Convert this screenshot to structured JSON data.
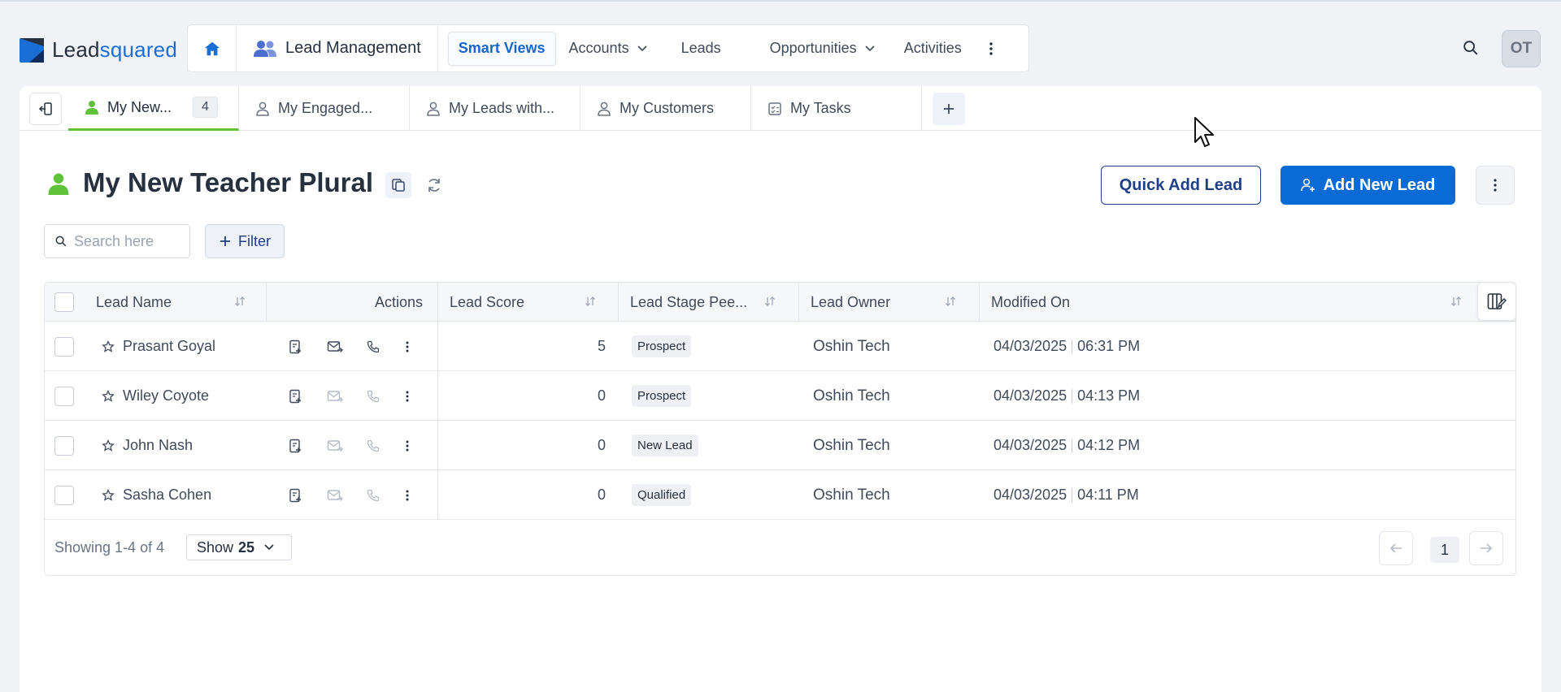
{
  "brand": {
    "name_part1": "Lead",
    "name_part2": "squared",
    "accent": "#1a6fd6"
  },
  "nav": {
    "module": "Lead Management",
    "items": [
      {
        "label": "Smart Views",
        "active": true
      },
      {
        "label": "Accounts",
        "dropdown": true
      },
      {
        "label": "Leads"
      },
      {
        "label": "Opportunities",
        "dropdown": true
      },
      {
        "label": "Activities"
      }
    ]
  },
  "user": {
    "initials": "OT"
  },
  "tabs": [
    {
      "label": "My New...",
      "count": "4",
      "active": true
    },
    {
      "label": "My Engaged..."
    },
    {
      "label": "My Leads with..."
    },
    {
      "label": "My Customers"
    },
    {
      "label": "My Tasks"
    }
  ],
  "page": {
    "title": "My New Teacher Plural",
    "quick_add_label": "Quick Add Lead",
    "add_new_label": "Add New Lead",
    "search_placeholder": "Search here",
    "filter_label": "Filter"
  },
  "table": {
    "columns": {
      "lead_name": "Lead Name",
      "actions": "Actions",
      "lead_score": "Lead Score",
      "lead_stage": "Lead Stage Pee...",
      "lead_owner": "Lead Owner",
      "modified_on": "Modified On"
    },
    "rows": [
      {
        "name": "Prasant Goyal",
        "score": "5",
        "stage": "Prospect",
        "owner": "Oshin Tech",
        "date": "04/03/2025",
        "time": "06:31 PM"
      },
      {
        "name": "Wiley Coyote",
        "score": "0",
        "stage": "Prospect",
        "owner": "Oshin Tech",
        "date": "04/03/2025",
        "time": "04:13 PM"
      },
      {
        "name": "John Nash",
        "score": "0",
        "stage": "New Lead",
        "owner": "Oshin Tech",
        "date": "04/03/2025",
        "time": "04:12 PM"
      },
      {
        "name": "Sasha Cohen",
        "score": "0",
        "stage": "Qualified",
        "owner": "Oshin Tech",
        "date": "04/03/2025",
        "time": "04:11 PM"
      }
    ],
    "footer": {
      "showing": "Showing 1-4 of 4",
      "show_label": "Show",
      "page_size": "25",
      "current_page": "1"
    }
  }
}
